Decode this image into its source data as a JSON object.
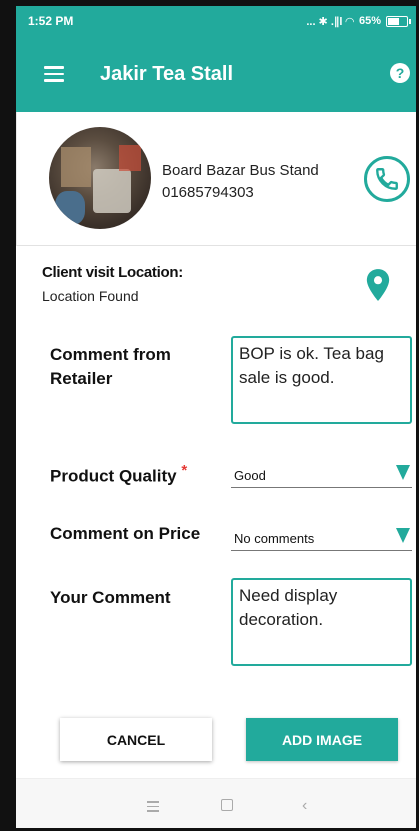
{
  "status_bar": {
    "time": "1:52 PM",
    "signals": "... ✱ .∥l ◠",
    "battery_percent": "65%",
    "battery_level": 0.65
  },
  "app_bar": {
    "title": "Jakir Tea Stall",
    "menu_icon": "hamburger-icon",
    "help_icon": "help-icon",
    "help_glyph": "?"
  },
  "retailer": {
    "location": "Board Bazar Bus Stand",
    "phone": "01685794303",
    "call_icon": "phone-icon"
  },
  "visit_location": {
    "label": "Client visit Location:",
    "value": "Location Found",
    "icon": "map-marker-icon"
  },
  "form": {
    "retailer_comment": {
      "label": "Comment from Retailer",
      "value": "BOP is ok. Tea bag sale is good."
    },
    "product_quality": {
      "label": "Product Quality",
      "required_mark": "*",
      "value": "Good"
    },
    "price_comment": {
      "label": "Comment on Price",
      "value": "No comments"
    },
    "your_comment": {
      "label": "Your Comment",
      "value": "Need display decoration."
    }
  },
  "buttons": {
    "cancel": "CANCEL",
    "add_image": "ADD IMAGE"
  },
  "colors": {
    "accent": "#22aa9c",
    "required": "#e53935"
  }
}
